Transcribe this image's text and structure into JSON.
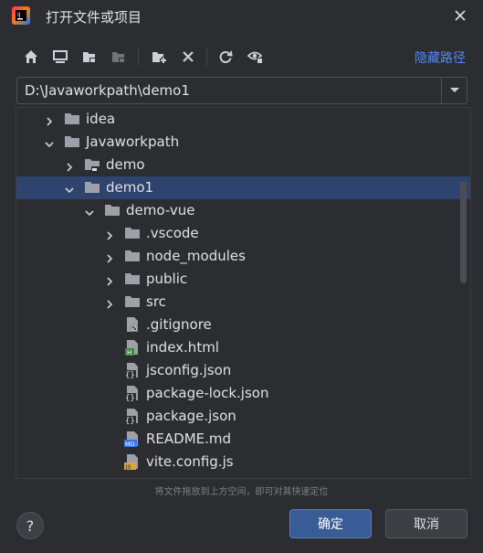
{
  "window": {
    "title": "打开文件或项目"
  },
  "toolbar": {
    "hide_path": "隐藏路径"
  },
  "path": {
    "value": "D:\\Javaworkpath\\demo1"
  },
  "tree": {
    "rows": [
      {
        "label": "idea",
        "depth": 1,
        "arrow": "right",
        "icon": "folder"
      },
      {
        "label": "Javaworkpath",
        "depth": 1,
        "arrow": "down",
        "icon": "folder"
      },
      {
        "label": "demo",
        "depth": 2,
        "arrow": "right",
        "icon": "module-folder"
      },
      {
        "label": "demo1",
        "depth": 2,
        "arrow": "down",
        "icon": "folder",
        "selected": true
      },
      {
        "label": "demo-vue",
        "depth": 3,
        "arrow": "down",
        "icon": "folder"
      },
      {
        "label": ".vscode",
        "depth": 4,
        "arrow": "right",
        "icon": "folder"
      },
      {
        "label": "node_modules",
        "depth": 4,
        "arrow": "right",
        "icon": "folder"
      },
      {
        "label": "public",
        "depth": 4,
        "arrow": "right",
        "icon": "folder"
      },
      {
        "label": "src",
        "depth": 4,
        "arrow": "right",
        "icon": "folder"
      },
      {
        "label": ".gitignore",
        "depth": 4,
        "arrow": "none",
        "icon": "ignore-file"
      },
      {
        "label": "index.html",
        "depth": 4,
        "arrow": "none",
        "icon": "html-file"
      },
      {
        "label": "jsconfig.json",
        "depth": 4,
        "arrow": "none",
        "icon": "json-file"
      },
      {
        "label": "package-lock.json",
        "depth": 4,
        "arrow": "none",
        "icon": "json-file"
      },
      {
        "label": "package.json",
        "depth": 4,
        "arrow": "none",
        "icon": "json-file"
      },
      {
        "label": "README.md",
        "depth": 4,
        "arrow": "none",
        "icon": "md-file"
      },
      {
        "label": "vite.config.js",
        "depth": 4,
        "arrow": "none",
        "icon": "js-file"
      }
    ]
  },
  "hint": "将文件拖放到上方空间，即可对其快速定位",
  "buttons": {
    "help": "?",
    "ok": "确定",
    "cancel": "取消"
  }
}
